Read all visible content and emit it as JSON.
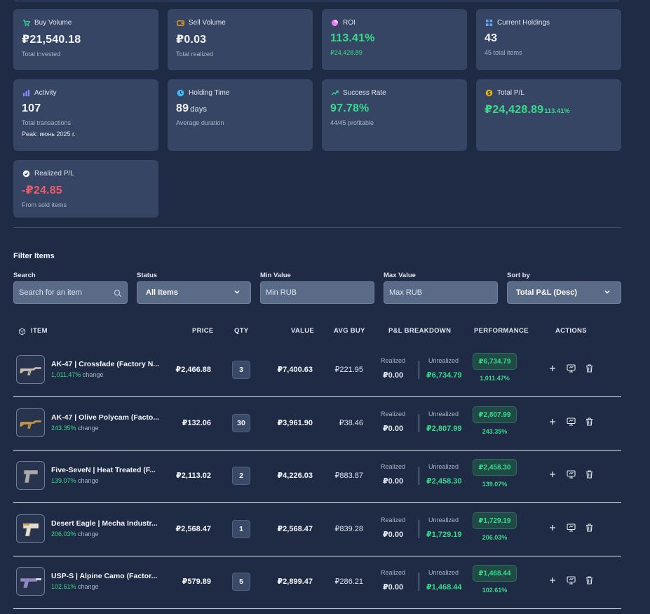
{
  "stats": [
    {
      "label": "Buy Volume",
      "value": "₽21,540.18",
      "sub": "Total invested",
      "icon": "cart-icon"
    },
    {
      "label": "Sell Volume",
      "value": "₽0.03",
      "sub": "Total realized",
      "icon": "wallet-icon"
    },
    {
      "label": "ROI",
      "value": "113.41%",
      "sub": "₽24,428.89",
      "icon": "pie-chart-icon"
    },
    {
      "label": "Current Holdings",
      "value": "43",
      "sub": "45 total items",
      "icon": "grid-icon"
    },
    {
      "label": "Activity",
      "value": "107",
      "sub": "Total transactions",
      "extra": "Peak: июнь 2025 г.",
      "icon": "bar-chart-icon"
    },
    {
      "label": "Holding Time",
      "value": "89",
      "unit": "days",
      "sub": "Average duration",
      "icon": "clock-icon"
    },
    {
      "label": "Success Rate",
      "value": "97.78%",
      "sub": "44/45 profitable",
      "icon": "trend-up-icon"
    },
    {
      "label": "Total P/L",
      "value": "₽24,428.89",
      "inline": "113.41%",
      "icon": "dollar-coin-icon"
    },
    {
      "label": "Realized P/L",
      "value": "-₽24.85",
      "sub": "From sold items",
      "icon": "check-circle-icon"
    }
  ],
  "filters": {
    "title": "Filter Items",
    "search_label": "Search",
    "search_placeholder": "Search for an item",
    "status_label": "Status",
    "status_value": "All Items",
    "min_label": "Min Value",
    "min_placeholder": "Min RUB",
    "max_label": "Max Value",
    "max_placeholder": "Max RUB",
    "sort_label": "Sort by",
    "sort_value": "Total P&L (Desc)"
  },
  "table": {
    "headers": {
      "item": "ITEM",
      "price": "PRICE",
      "qty": "QTY",
      "value": "VALUE",
      "avg_buy": "AVG BUY",
      "breakdown": "P&L BREAKDOWN",
      "performance": "PERFORMANCE",
      "actions": "ACTIONS"
    },
    "realized_label": "Realized",
    "unrealized_label": "Unrealized",
    "change_word": "change",
    "rows": [
      {
        "name": "AK-47 | Crossfade (Factory N...",
        "change": "1,011.47%",
        "price": "₽2,466.88",
        "qty": "3",
        "value": "₽7,400.63",
        "avg_buy": "₽221.95",
        "realized": "₽0.00",
        "unrealized": "₽6,734.79",
        "perf_value": "₽6,734.79",
        "perf_pct": "1,011.47%",
        "weapon": "rifle",
        "skin_color": "#c9c2b8"
      },
      {
        "name": "AK-47 | Olive Polycam (Facto...",
        "change": "243.35%",
        "price": "₽132.06",
        "qty": "30",
        "value": "₽3,961.90",
        "avg_buy": "₽38.46",
        "realized": "₽0.00",
        "unrealized": "₽2,807.99",
        "perf_value": "₽2,807.99",
        "perf_pct": "243.35%",
        "weapon": "rifle",
        "skin_color": "#c59b45"
      },
      {
        "name": "Five-SeveN | Heat Treated (F...",
        "change": "139.07%",
        "price": "₽2,113.02",
        "qty": "2",
        "value": "₽4,226.03",
        "avg_buy": "₽883.87",
        "realized": "₽0.00",
        "unrealized": "₽2,458.30",
        "perf_value": "₽2,458.30",
        "perf_pct": "139.07%",
        "weapon": "pistol",
        "skin_color": "#a7a9ad"
      },
      {
        "name": "Desert Eagle | Mecha Industr...",
        "change": "206.03%",
        "price": "₽2,568.47",
        "qty": "1",
        "value": "₽2,568.47",
        "avg_buy": "₽839.28",
        "realized": "₽0.00",
        "unrealized": "₽1,729.19",
        "perf_value": "₽1,729.19",
        "perf_pct": "206.03%",
        "weapon": "deagle",
        "skin_color": "#e6ddd0"
      },
      {
        "name": "USP-S | Alpine Camo (Factor...",
        "change": "102.61%",
        "price": "₽579.89",
        "qty": "5",
        "value": "₽2,899.47",
        "avg_buy": "₽286.21",
        "realized": "₽0.00",
        "unrealized": "₽1,468.44",
        "perf_value": "₽1,468.44",
        "perf_pct": "102.61%",
        "weapon": "usp",
        "skin_color": "#8f86c9"
      }
    ]
  }
}
